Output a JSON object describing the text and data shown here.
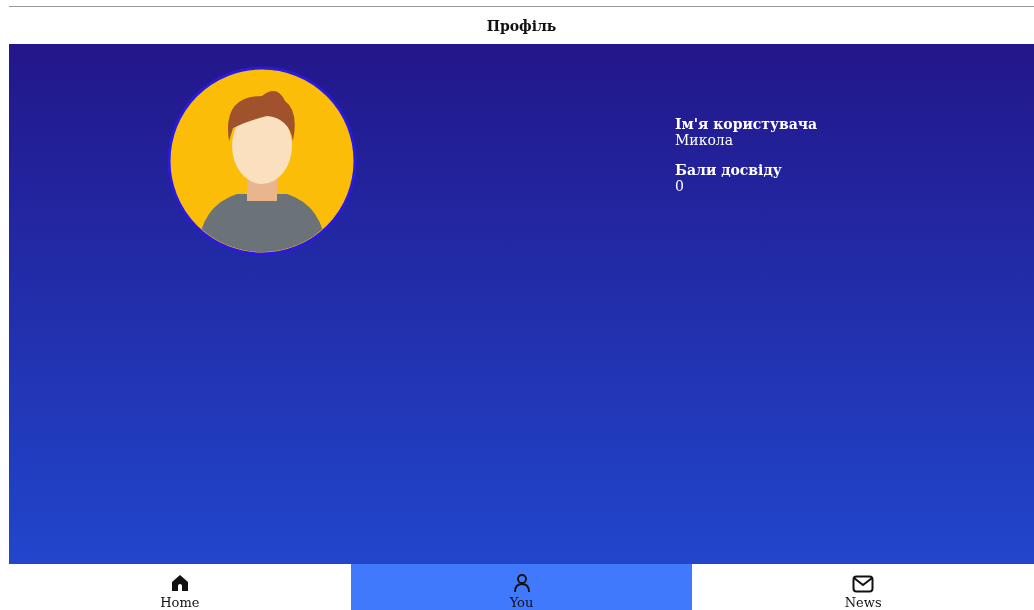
{
  "header": {
    "title": "Профіль"
  },
  "profile": {
    "fields": [
      {
        "label": "Ім'я користувача",
        "value": "Микола"
      },
      {
        "label": "Бали досвіду",
        "value": "0"
      }
    ]
  },
  "nav": [
    {
      "label": "Home",
      "selected": false
    },
    {
      "label": "You",
      "selected": true
    },
    {
      "label": "News",
      "selected": false
    }
  ]
}
